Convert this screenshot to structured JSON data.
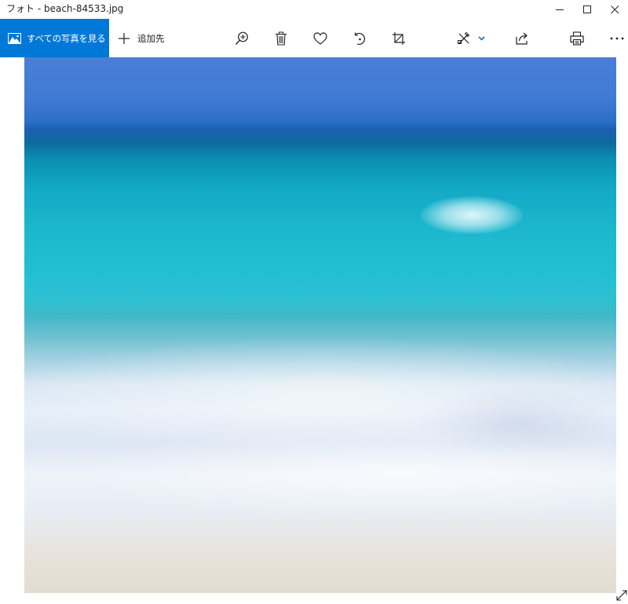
{
  "window": {
    "title": "フォト - beach-84533.jpg"
  },
  "titlebar_controls": [
    {
      "name": "minimize",
      "icon": "minimize-icon"
    },
    {
      "name": "maximize",
      "icon": "maximize-icon"
    },
    {
      "name": "close",
      "icon": "close-icon"
    }
  ],
  "toolbar": {
    "all_photos_label": "すべての写真を見る",
    "add_to_label": "追加先",
    "buttons": [
      {
        "name": "zoom-in",
        "icon": "zoom-in-icon"
      },
      {
        "name": "delete",
        "icon": "trash-icon"
      },
      {
        "name": "favorite",
        "icon": "heart-icon"
      },
      {
        "name": "rotate",
        "icon": "rotate-icon"
      },
      {
        "name": "crop",
        "icon": "crop-icon"
      },
      {
        "name": "edit-create",
        "icon": "edit-create-icon"
      },
      {
        "name": "share",
        "icon": "share-icon"
      },
      {
        "name": "print",
        "icon": "printer-icon"
      },
      {
        "name": "more",
        "icon": "more-icon"
      }
    ]
  },
  "image": {
    "subject": "blurred beach with turquoise sea and white foam"
  },
  "colors": {
    "accent": "#0078d7",
    "text": "#222222",
    "background": "#ffffff"
  }
}
